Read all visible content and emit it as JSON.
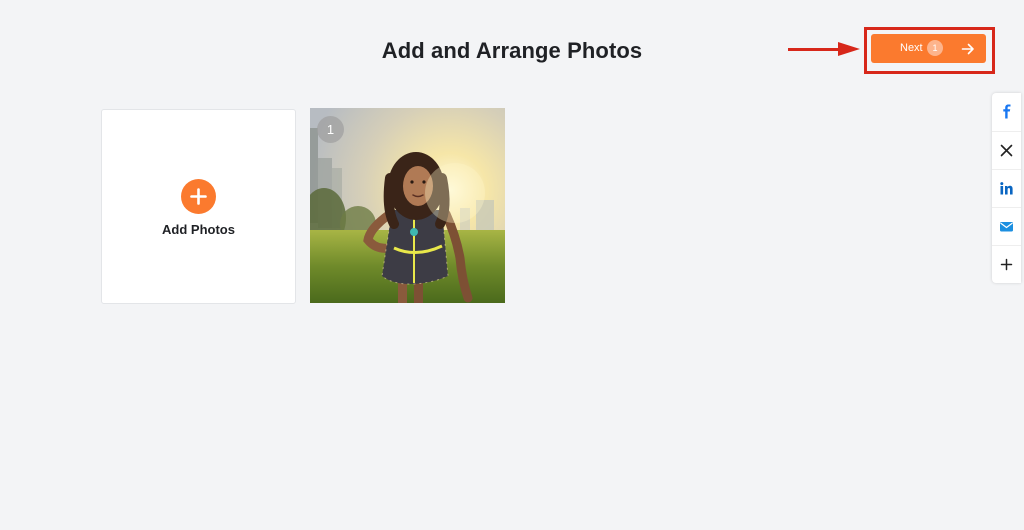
{
  "header": {
    "title": "Add and Arrange Photos"
  },
  "next_button": {
    "label": "Next",
    "count": "1",
    "icon": "arrow-right-icon"
  },
  "add_card": {
    "label": "Add Photos",
    "icon": "plus-icon"
  },
  "photos": [
    {
      "order": "1",
      "subject": "girl in checkered dress standing in grassy field at sunset"
    }
  ],
  "share_bar": {
    "items": [
      {
        "icon": "facebook-icon"
      },
      {
        "icon": "x-icon"
      },
      {
        "icon": "linkedin-icon"
      },
      {
        "icon": "email-icon"
      },
      {
        "icon": "plus-icon"
      }
    ]
  },
  "colors": {
    "accent": "#fb7a2e",
    "annotation": "#d7271a",
    "background": "#f3f4f6",
    "facebook": "#1877f2",
    "linkedin": "#0a66c2",
    "email": "#1c8fe0"
  }
}
